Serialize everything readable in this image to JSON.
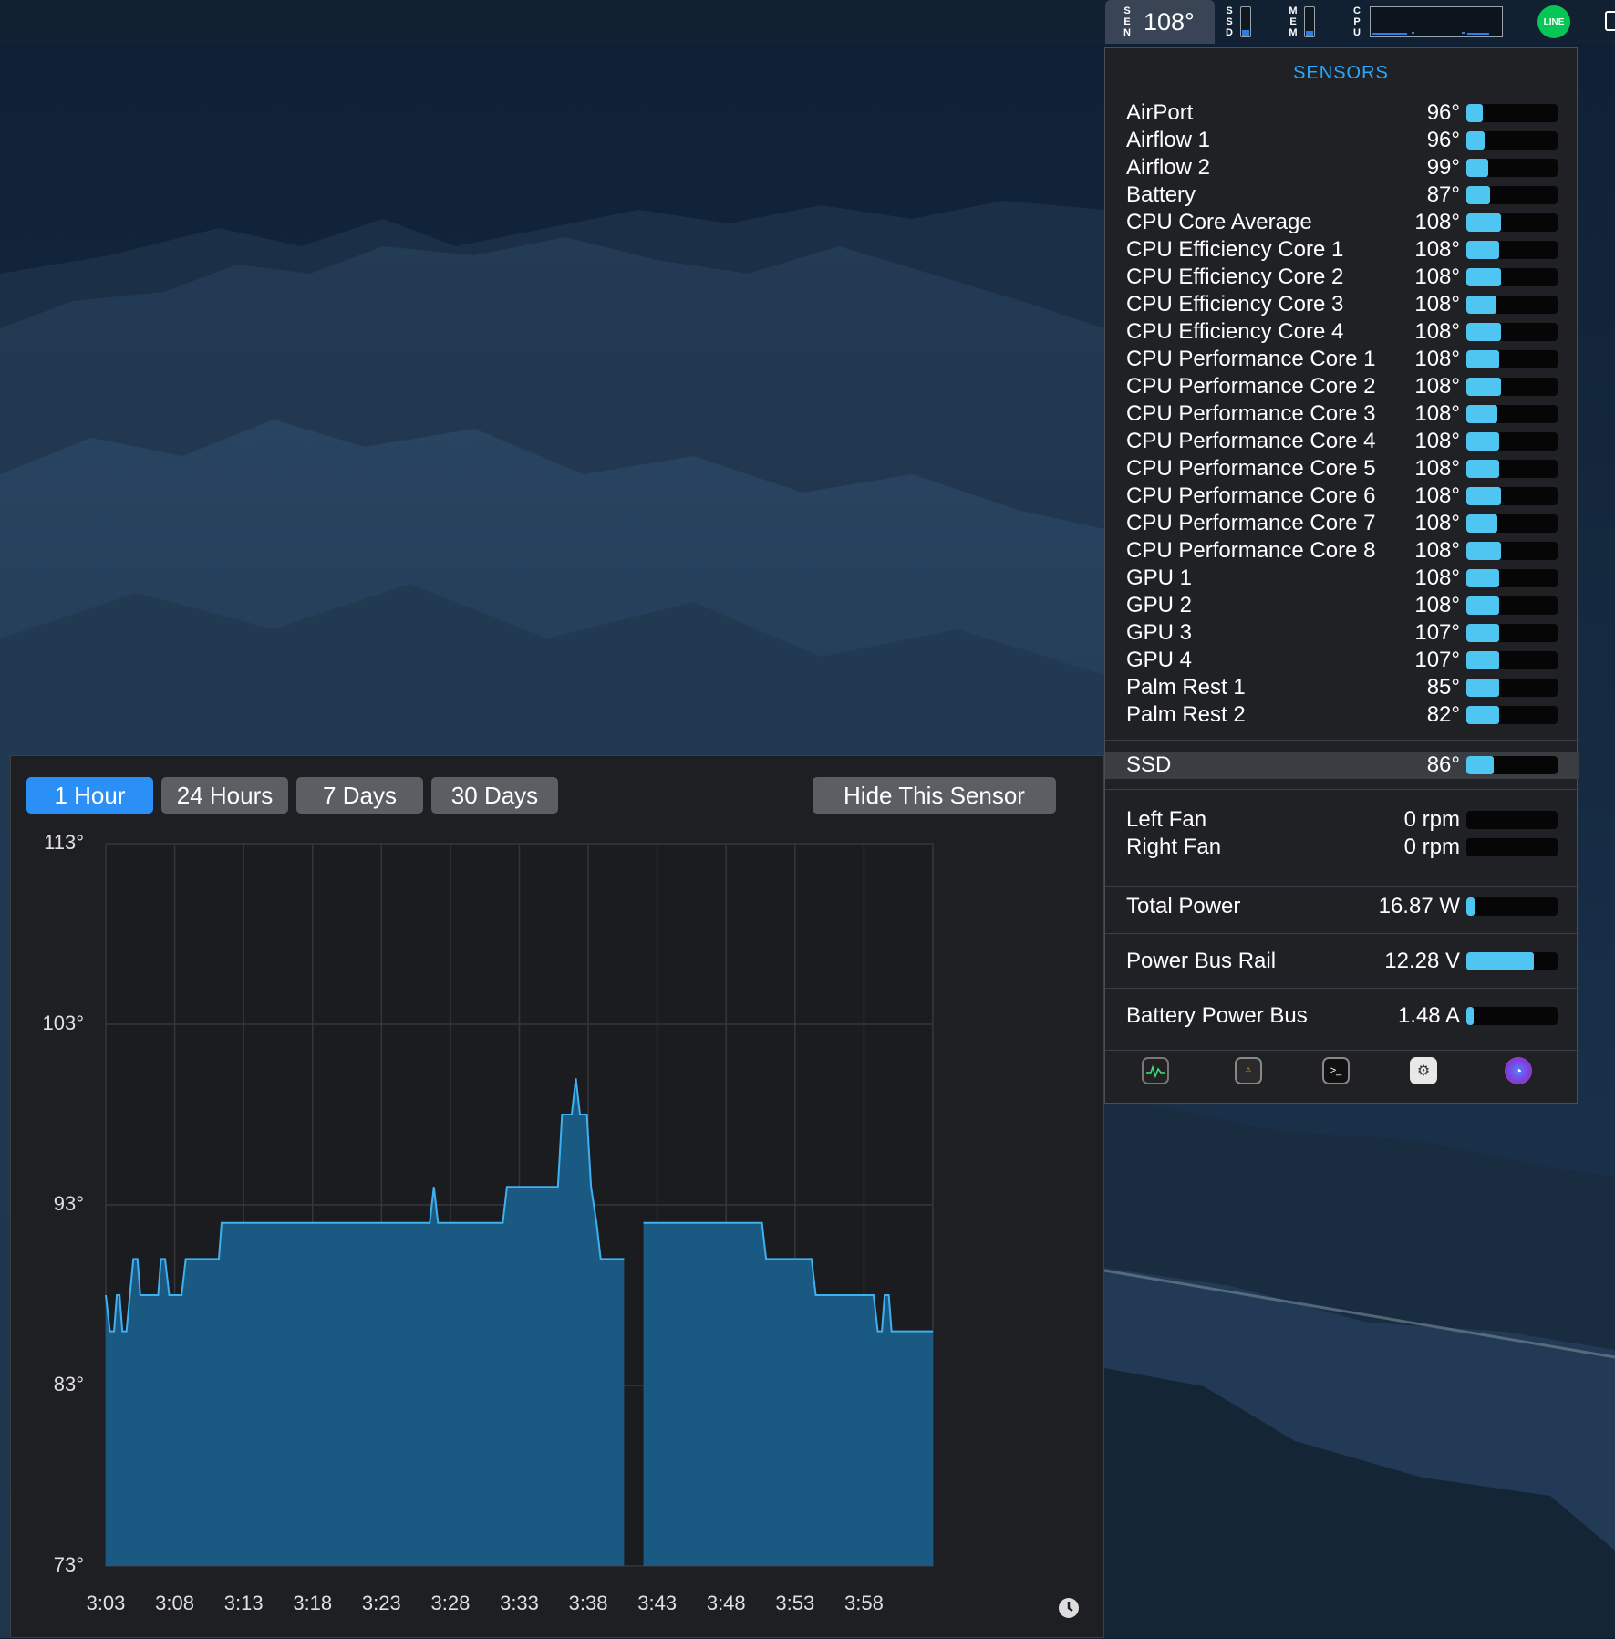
{
  "menubar": {
    "sensors_label": "SEN",
    "sensors_value": "108°",
    "ssd_label": "SSD",
    "ssd_level": 0.2,
    "mem_label": "MEM",
    "mem_level": 0.15,
    "cpu_label": "CPU",
    "line_badge": "LINE"
  },
  "sensors_panel": {
    "heading": "SENSORS",
    "accent_color": "#2aa7ff",
    "bar_color": "#4fc6f2",
    "temperatures": [
      {
        "name": "AirPort",
        "value": "96°",
        "level": 0.18
      },
      {
        "name": "Airflow 1",
        "value": "96°",
        "level": 0.2
      },
      {
        "name": "Airflow 2",
        "value": "99°",
        "level": 0.24
      },
      {
        "name": "Battery",
        "value": "87°",
        "level": 0.26
      },
      {
        "name": "CPU Core Average",
        "value": "108°",
        "level": 0.38
      },
      {
        "name": "CPU Efficiency Core 1",
        "value": "108°",
        "level": 0.36
      },
      {
        "name": "CPU Efficiency Core 2",
        "value": "108°",
        "level": 0.38
      },
      {
        "name": "CPU Efficiency Core 3",
        "value": "108°",
        "level": 0.33
      },
      {
        "name": "CPU Efficiency Core 4",
        "value": "108°",
        "level": 0.38
      },
      {
        "name": "CPU Performance Core 1",
        "value": "108°",
        "level": 0.36
      },
      {
        "name": "CPU Performance Core 2",
        "value": "108°",
        "level": 0.38
      },
      {
        "name": "CPU Performance Core 3",
        "value": "108°",
        "level": 0.34
      },
      {
        "name": "CPU Performance Core 4",
        "value": "108°",
        "level": 0.36
      },
      {
        "name": "CPU Performance Core 5",
        "value": "108°",
        "level": 0.36
      },
      {
        "name": "CPU Performance Core 6",
        "value": "108°",
        "level": 0.38
      },
      {
        "name": "CPU Performance Core 7",
        "value": "108°",
        "level": 0.34
      },
      {
        "name": "CPU Performance Core 8",
        "value": "108°",
        "level": 0.38
      },
      {
        "name": "GPU 1",
        "value": "108°",
        "level": 0.36
      },
      {
        "name": "GPU 2",
        "value": "108°",
        "level": 0.36
      },
      {
        "name": "GPU 3",
        "value": "107°",
        "level": 0.36
      },
      {
        "name": "GPU 4",
        "value": "107°",
        "level": 0.36
      },
      {
        "name": "Palm Rest 1",
        "value": "85°",
        "level": 0.36
      },
      {
        "name": "Palm Rest 2",
        "value": "82°",
        "level": 0.36
      }
    ],
    "ssd": {
      "name": "SSD",
      "value": "86°",
      "level": 0.3
    },
    "fans": [
      {
        "name": "Left Fan",
        "value": "0 rpm",
        "level": 0
      },
      {
        "name": "Right Fan",
        "value": "0 rpm",
        "level": 0
      }
    ],
    "power": [
      {
        "name": "Total Power",
        "value": "16.87 W",
        "level": 0.09
      },
      {
        "name": "Power Bus Rail",
        "value": "12.28 V",
        "level": 0.74
      },
      {
        "name": "Battery Power Bus",
        "value": "1.48 A",
        "level": 0.08
      }
    ],
    "tools": [
      "activity-monitor-icon",
      "console-icon",
      "terminal-icon",
      "system-information-icon",
      "istat-menus-icon"
    ]
  },
  "history_window": {
    "range_buttons": [
      "1 Hour",
      "24 Hours",
      "7 Days",
      "30 Days"
    ],
    "active_range": "1 Hour",
    "hide_button": "Hide This Sensor",
    "active_color": "#2a8ff7"
  },
  "chart_data": {
    "type": "area",
    "title": "",
    "xlabel": "",
    "ylabel": "",
    "y_ticks": [
      "113°",
      "103°",
      "93°",
      "83°",
      "73°"
    ],
    "ylim": [
      73,
      113
    ],
    "x_ticks": [
      "3:03",
      "3:08",
      "3:13",
      "3:18",
      "3:23",
      "3:28",
      "3:33",
      "3:38",
      "3:43",
      "3:48",
      "3:53",
      "3:58"
    ],
    "x_range_minutes": [
      0,
      60
    ],
    "grid": true,
    "fill_color": "#1a5a82",
    "line_color": "#3fb0f0",
    "series": [
      {
        "segments": [
          [
            [
              0,
              88
            ],
            [
              0.3,
              86
            ],
            [
              0.6,
              86
            ],
            [
              0.8,
              88
            ],
            [
              1.0,
              88
            ],
            [
              1.2,
              86
            ],
            [
              1.5,
              86
            ],
            [
              2.0,
              90
            ],
            [
              2.3,
              90
            ],
            [
              2.5,
              88
            ],
            [
              3.8,
              88
            ],
            [
              4.0,
              90
            ],
            [
              4.3,
              90
            ],
            [
              4.6,
              88
            ],
            [
              5.5,
              88
            ],
            [
              5.8,
              90
            ],
            [
              8.2,
              90
            ],
            [
              8.4,
              92
            ],
            [
              23.5,
              92
            ],
            [
              23.8,
              94
            ],
            [
              24.1,
              92
            ],
            [
              28.8,
              92
            ],
            [
              29.1,
              94
            ],
            [
              32.8,
              94
            ],
            [
              33.1,
              98
            ],
            [
              33.8,
              98
            ],
            [
              34.1,
              100
            ],
            [
              34.4,
              98
            ],
            [
              34.9,
              98
            ],
            [
              35.2,
              94
            ],
            [
              35.6,
              92
            ],
            [
              35.9,
              90
            ],
            [
              37.6,
              90
            ]
          ],
          [
            [
              39.0,
              92
            ],
            [
              47.6,
              92
            ],
            [
              47.9,
              90
            ],
            [
              51.2,
              90
            ],
            [
              51.5,
              88
            ],
            [
              55.7,
              88
            ],
            [
              56.0,
              86
            ],
            [
              56.3,
              86
            ],
            [
              56.5,
              88
            ],
            [
              56.8,
              88
            ],
            [
              57.0,
              86
            ],
            [
              60,
              86
            ]
          ]
        ]
      }
    ]
  }
}
